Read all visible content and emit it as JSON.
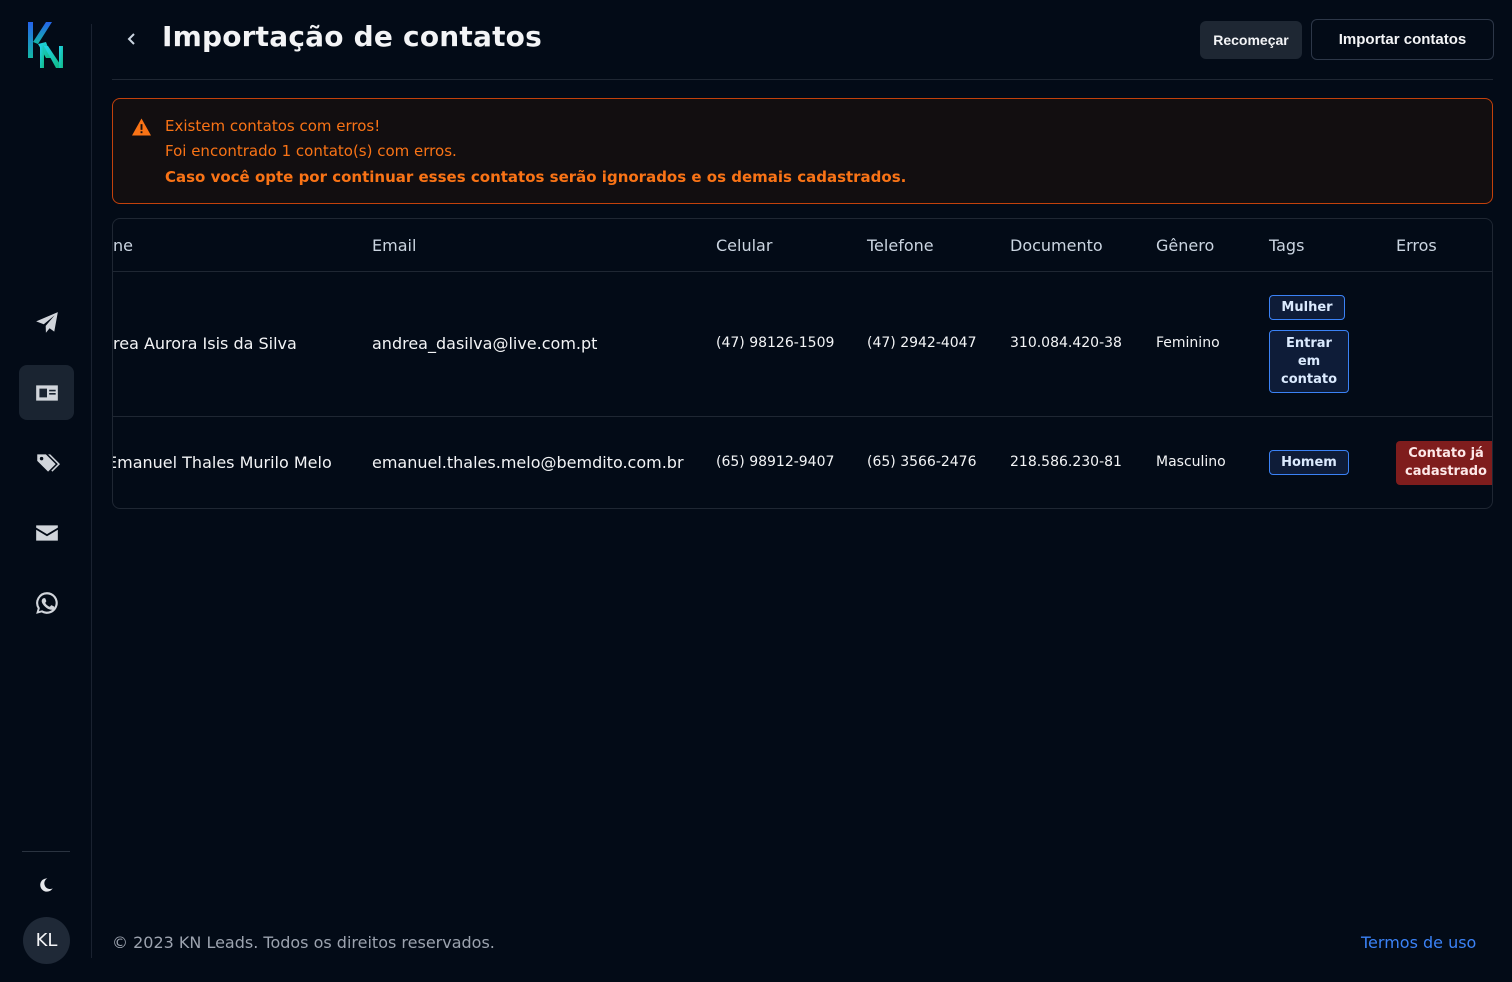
{
  "header": {
    "title": "Importação de contatos",
    "restart_label": "Recomeçar",
    "import_label": "Importar contatos"
  },
  "alert": {
    "title": "Existem contatos com erros!",
    "message": "Foi encontrado 1 contato(s) com erros.",
    "detail": "Caso você opte por continuar esses contatos serão ignorados e os demais cadastrados."
  },
  "table": {
    "columns": [
      "ne",
      "Email",
      "Celular",
      "Telefone",
      "Documento",
      "Gênero",
      "Tags",
      "Erros"
    ],
    "rows": [
      {
        "name": "rea Aurora Isis da Silva",
        "email": "andrea_dasilva@live.com.pt",
        "celular": "(47) 98126-1509",
        "telefone": "(47) 2942-4047",
        "documento": "310.084.420-38",
        "genero": "Feminino",
        "tags": [
          "Mulher",
          "Entrar em contato"
        ],
        "erros": ""
      },
      {
        "name": "Emanuel Thales Murilo Melo",
        "email": "emanuel.thales.melo@bemdito.com.br",
        "celular": "(65) 98912-9407",
        "telefone": "(65) 3566-2476",
        "documento": "218.586.230-81",
        "genero": "Masculino",
        "tags": [
          "Homem"
        ],
        "erros": "Contato já cadastrado"
      }
    ]
  },
  "sidebar": {
    "items": [
      {
        "icon": "paper-plane-icon"
      },
      {
        "icon": "contact-card-icon",
        "active": true
      },
      {
        "icon": "tags-icon"
      },
      {
        "icon": "envelope-icon"
      },
      {
        "icon": "whatsapp-icon"
      }
    ],
    "avatar_initials": "KL"
  },
  "footer": {
    "copyright": "© 2023 KN Leads. Todos os direitos reservados.",
    "terms": "Termos de uso"
  },
  "colors": {
    "background": "#030b17",
    "warning": "#f97316",
    "tag_border": "#3b82f6",
    "error_badge": "#7f1d1d",
    "link": "#3b82f6"
  }
}
